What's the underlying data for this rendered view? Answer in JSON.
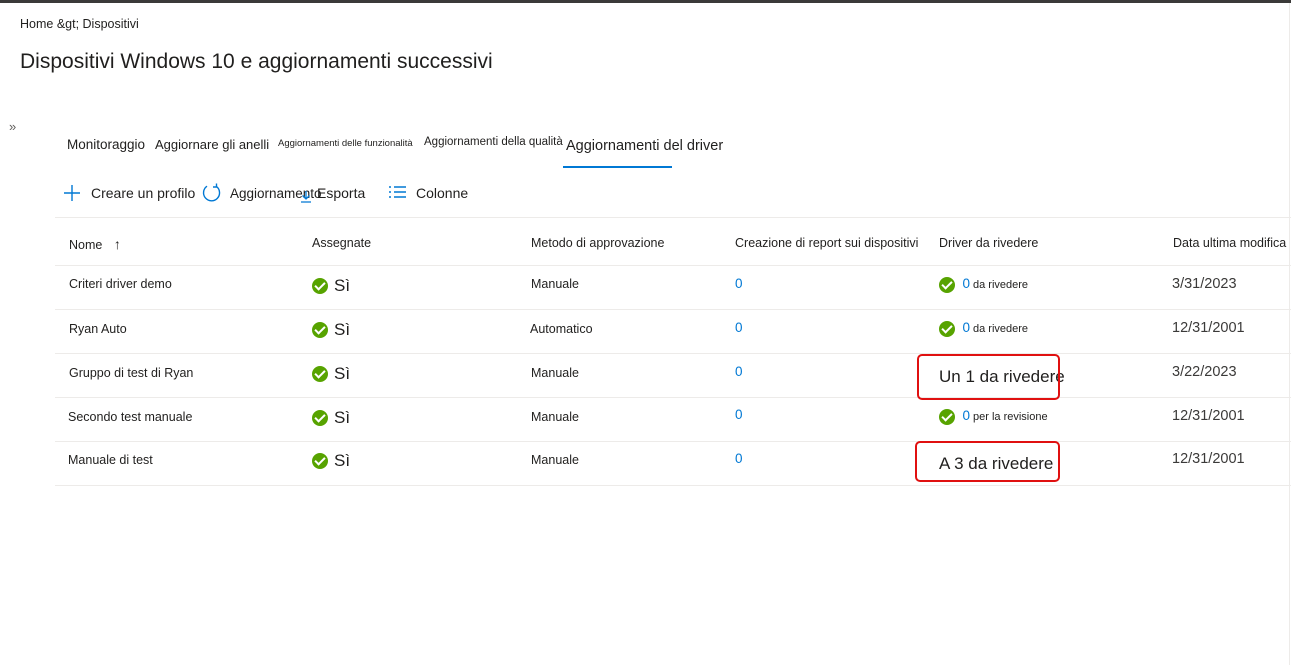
{
  "breadcrumb": {
    "text": "Home &gt;  Dispositivi"
  },
  "page_title": "Dispositivi Windows 10 e aggiornamenti successivi",
  "expand_glyph": "»",
  "tabs": [
    {
      "label": "Monitoraggio"
    },
    {
      "label": "Aggiornare gli anelli"
    },
    {
      "label": "Aggiornamenti delle funzionalità"
    },
    {
      "label": "Aggiornamenti della qualità"
    },
    {
      "label": "Aggiornamenti del driver"
    }
  ],
  "active_tab": "Aggiornamenti del driver",
  "toolbar": {
    "create_label": "Creare un profilo",
    "refresh_label": "Aggiornamento",
    "export_label": "Esporta",
    "columns_label": "Colonne"
  },
  "table": {
    "headers": {
      "name": "Nome",
      "assigned": "Assegnate",
      "method": "Metodo di approvazione",
      "reporting": "Creazione di report sui dispositivi",
      "drivers": "Driver da rivedere",
      "modified": "Data ultima modifica"
    },
    "sort_glyph": "↑",
    "rows": [
      {
        "name": "Criteri driver demo",
        "assigned": "Sì",
        "method": "Manuale",
        "reporting": "0",
        "drivers_count": "0",
        "drivers_text": "da rivedere",
        "modified": "3/31/2023"
      },
      {
        "name": "Ryan Auto",
        "assigned": "Sì",
        "method": "Automatico",
        "reporting": "0",
        "drivers_count": "0",
        "drivers_text": "da rivedere",
        "modified": "12/31/2001"
      },
      {
        "name": "Gruppo di test di Ryan",
        "assigned": "Sì",
        "method": "Manuale",
        "reporting": "0",
        "drivers_full": "Un 1 da rivedere",
        "modified": "3/22/2023"
      },
      {
        "name": "Secondo test manuale",
        "assigned": "Sì",
        "method": "Manuale",
        "reporting": "0",
        "drivers_count": "0",
        "drivers_text": "per la revisione",
        "modified": "12/31/2001"
      },
      {
        "name": "Manuale di test",
        "assigned": "Sì",
        "method": "Manuale",
        "reporting": "0",
        "drivers_full": "A 3 da rivedere",
        "modified": "12/31/2001"
      }
    ]
  },
  "colors": {
    "accent": "#0078d4",
    "success": "#57a300",
    "highlight": "#e01010"
  }
}
